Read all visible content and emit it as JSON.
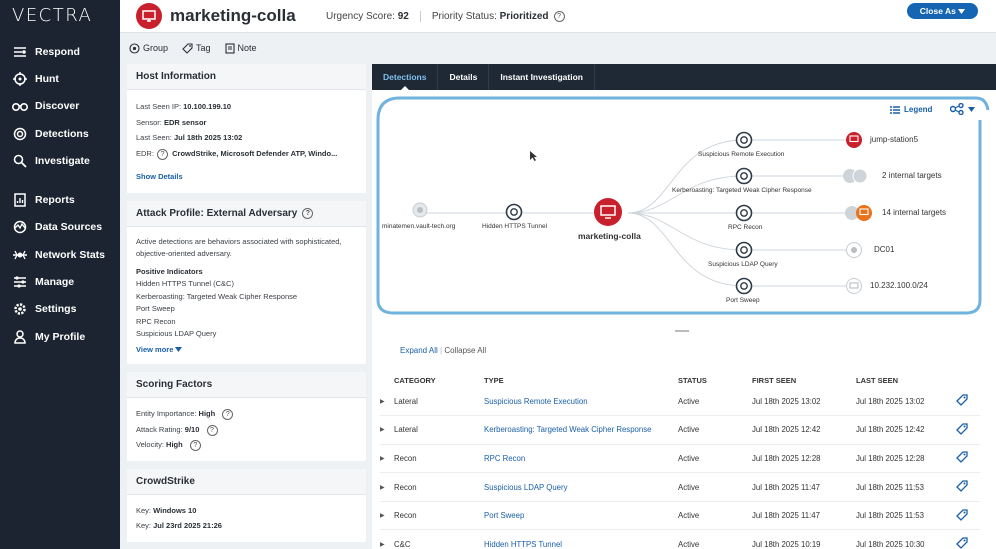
{
  "app": {
    "logo": "VECTRA"
  },
  "nav": [
    {
      "label": "Respond",
      "icon": "respond-icon"
    },
    {
      "label": "Hunt",
      "icon": "crosshair-icon"
    },
    {
      "label": "Discover",
      "icon": "binoculars-icon"
    },
    {
      "label": "Detections",
      "icon": "detections-icon"
    },
    {
      "label": "Investigate",
      "icon": "magnifier-icon"
    },
    {
      "label": "Reports",
      "icon": "report-icon"
    },
    {
      "label": "Data Sources",
      "icon": "datasource-icon"
    },
    {
      "label": "Network Stats",
      "icon": "network-icon"
    },
    {
      "label": "Manage",
      "icon": "manage-icon"
    },
    {
      "label": "Settings",
      "icon": "gear-icon"
    },
    {
      "label": "My Profile",
      "icon": "user-icon"
    }
  ],
  "header": {
    "host_name": "marketing-colla",
    "urgency_label": "Urgency Score:",
    "urgency_value": "92",
    "priority_label": "Priority Status:",
    "priority_value": "Prioritized",
    "close_label": "Close As"
  },
  "actions": {
    "group": "Group",
    "tag": "Tag",
    "note": "Note"
  },
  "host_info": {
    "title": "Host Information",
    "last_seen_ip_label": "Last Seen IP:",
    "last_seen_ip": "10.100.199.10",
    "sensor_label": "Sensor:",
    "sensor": "EDR sensor",
    "last_seen_label": "Last Seen:",
    "last_seen": "Jul 18th 2025 13:02",
    "edr_label": "EDR:",
    "edr": "CrowdStrike, Microsoft Defender ATP, Windo...",
    "show_details": "Show Details"
  },
  "attack_profile": {
    "title": "Attack Profile: External Adversary",
    "description": "Active detections are behaviors associated with sophisticated, objective-oriented adversary.",
    "positive_label": "Positive Indicators",
    "indicators": [
      "Hidden HTTPS Tunnel (C&C)",
      "Kerberoasting: Targeted Weak Cipher Response",
      "Port Sweep",
      "RPC Recon",
      "Suspicious LDAP Query"
    ],
    "view_more": "View more"
  },
  "scoring": {
    "title": "Scoring Factors",
    "importance_label": "Entity Importance:",
    "importance": "High",
    "attack_rating_label": "Attack Rating:",
    "attack_rating": "9/10",
    "velocity_label": "Velocity:",
    "velocity": "High"
  },
  "crowdstrike": {
    "title": "CrowdStrike",
    "key1_label": "Key:",
    "key1": "Windows 10",
    "key2_label": "Key:",
    "key2": "Jul 23rd 2025 21:26"
  },
  "tabs": [
    "Detections",
    "Details",
    "Instant Investigation"
  ],
  "graph": {
    "legend": "Legend",
    "source_node": "minatemen.vault-tech.org",
    "tunnel_node": "Hidden HTTPS Tunnel",
    "host_node": "marketing-colla",
    "detections": [
      "Suspicious Remote Execution",
      "Kerberoasting: Targeted Weak Cipher Response",
      "RPC Recon",
      "Suspicious LDAP Query",
      "Port Sweep"
    ],
    "targets": [
      "jump-station5",
      "2 internal targets",
      "14 internal targets",
      "DC01",
      "10.232.100.0/24"
    ]
  },
  "table": {
    "expand_all": "Expand All",
    "collapse_all": "Collapse All",
    "headers": [
      "CATEGORY",
      "TYPE",
      "STATUS",
      "FIRST SEEN",
      "LAST SEEN"
    ],
    "rows": [
      {
        "category": "Lateral",
        "type": "Suspicious Remote Execution",
        "status": "Active",
        "first": "Jul 18th 2025 13:02",
        "last": "Jul 18th 2025 13:02"
      },
      {
        "category": "Lateral",
        "type": "Kerberoasting: Targeted Weak Cipher Response",
        "status": "Active",
        "first": "Jul 18th 2025 12:42",
        "last": "Jul 18th 2025 12:42"
      },
      {
        "category": "Recon",
        "type": "RPC Recon",
        "status": "Active",
        "first": "Jul 18th 2025 12:28",
        "last": "Jul 18th 2025 12:28"
      },
      {
        "category": "Recon",
        "type": "Suspicious LDAP Query",
        "status": "Active",
        "first": "Jul 18th 2025 11:47",
        "last": "Jul 18th 2025 11:53"
      },
      {
        "category": "Recon",
        "type": "Port Sweep",
        "status": "Active",
        "first": "Jul 18th 2025 11:47",
        "last": "Jul 18th 2025 11:53"
      },
      {
        "category": "C&C",
        "type": "Hidden HTTPS Tunnel",
        "status": "Active",
        "first": "Jul 18th 2025 10:19",
        "last": "Jul 18th 2025 10:30"
      }
    ]
  },
  "colors": {
    "accent": "#1565b3",
    "danger": "#c8202c",
    "sidebar": "#1b2430",
    "graph_border": "#6fb3de"
  }
}
